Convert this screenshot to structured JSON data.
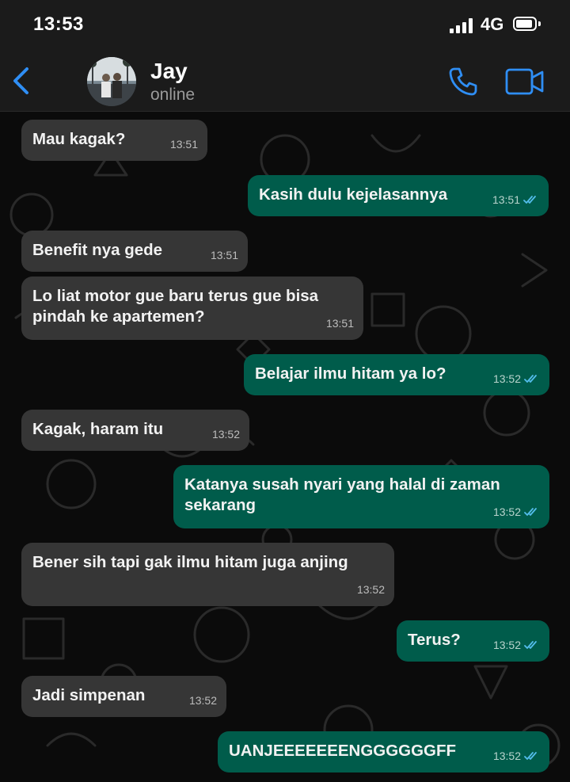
{
  "status_bar": {
    "time": "13:53",
    "network": "4G"
  },
  "header": {
    "name": "Jay",
    "status": "online"
  },
  "messages": [
    {
      "dir": "in",
      "text": "Mau kagak?",
      "time": "13:51"
    },
    {
      "dir": "out",
      "text": "Kasih dulu kejelasannya",
      "time": "13:51"
    },
    {
      "dir": "in",
      "text": "Benefit nya gede",
      "time": "13:51"
    },
    {
      "dir": "in",
      "text": "Lo liat motor gue baru terus gue bisa pindah ke apartemen?",
      "time": "13:51"
    },
    {
      "dir": "out",
      "text": "Belajar ilmu hitam ya lo?",
      "time": "13:52"
    },
    {
      "dir": "in",
      "text": "Kagak, haram itu",
      "time": "13:52"
    },
    {
      "dir": "out",
      "text": "Katanya susah nyari yang halal di zaman sekarang",
      "time": "13:52"
    },
    {
      "dir": "in",
      "text": "Bener sih tapi gak ilmu hitam juga anjing",
      "time": "13:52"
    },
    {
      "dir": "out",
      "text": "Terus?",
      "time": "13:52"
    },
    {
      "dir": "in",
      "text": "Jadi simpenan",
      "time": "13:52"
    },
    {
      "dir": "out",
      "text": "UANJEEEEEEENGGGGGGFF",
      "time": "13:52"
    }
  ],
  "colors": {
    "incoming": "#363636",
    "outgoing": "#005c4b",
    "accent": "#2f8ef4"
  }
}
